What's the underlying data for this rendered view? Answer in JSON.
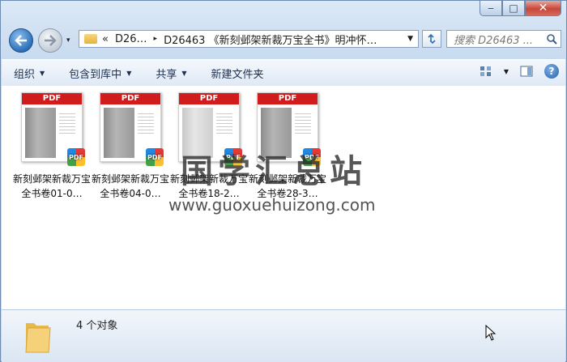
{
  "window": {
    "minimize": "‒",
    "maximize": "□",
    "close": "✕"
  },
  "address": {
    "history_glyph": "▾",
    "segments": [
      "D26…",
      "D26463 《新刻邺架新裁万宝全书》明冲怀…"
    ],
    "lead": "«",
    "separator": "▸"
  },
  "search": {
    "placeholder": "搜索 D26463 ..."
  },
  "toolbar": {
    "organize": "组织",
    "include_library": "包含到库中",
    "share": "共享",
    "new_folder": "新建文件夹",
    "help": "?"
  },
  "files": [
    {
      "badge": "PDF",
      "icon_badge": "PDF",
      "name": "新刻邺架新裁万宝全书卷01-0…"
    },
    {
      "badge": "PDF",
      "icon_badge": "PDF",
      "name": "新刻邺架新裁万宝全书卷04-0…"
    },
    {
      "badge": "PDF",
      "icon_badge": "PDF",
      "name": "新刻邺架新裁万宝全书卷18-2…"
    },
    {
      "badge": "PDF",
      "icon_badge": "PDF",
      "name": "新刻邺架新裁万宝全书卷28-3…"
    }
  ],
  "watermark": {
    "title": "国学汇总站",
    "url": "www.guoxuehuizong.com"
  },
  "status": {
    "count_text": "4 个对象"
  },
  "colors": {
    "pdf_red": "#d01c1c",
    "accent_blue": "#2c6fb8"
  }
}
